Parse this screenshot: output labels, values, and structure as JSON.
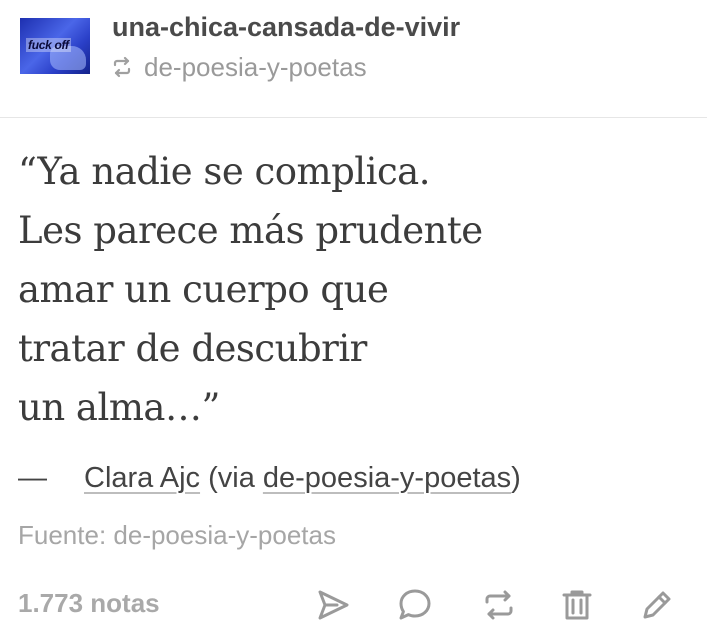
{
  "post": {
    "blog_name": "una-chica-cansada-de-vivir",
    "reblogged_from": "de-poesia-y-poetas",
    "avatar_caption": "fuck off",
    "quote_lines": [
      "“Ya nadie se complica.",
      "Les parece más prudente",
      "amar un cuerpo que",
      "tratar de descubrir",
      "un alma…”"
    ],
    "attribution": {
      "dash": "—",
      "author": "Clara Ajc",
      "via_prefix": " (via ",
      "via_blog": "de-poesia-y-poetas",
      "via_suffix": ")"
    },
    "source_label": "Fuente: de-poesia-y-poetas",
    "notes_count": "1.773 notas"
  },
  "icons": {
    "reblog_small": "reblog-icon",
    "share": "paper-plane-icon",
    "reply": "speech-bubble-icon",
    "reblog": "reblog-icon",
    "delete": "trash-icon",
    "edit": "pencil-icon"
  },
  "colors": {
    "text_primary": "#4a4a4a",
    "text_muted": "#9a9a9a",
    "icon_gray": "#9a9a9a",
    "avatar_blue": "#2a3fc7"
  }
}
